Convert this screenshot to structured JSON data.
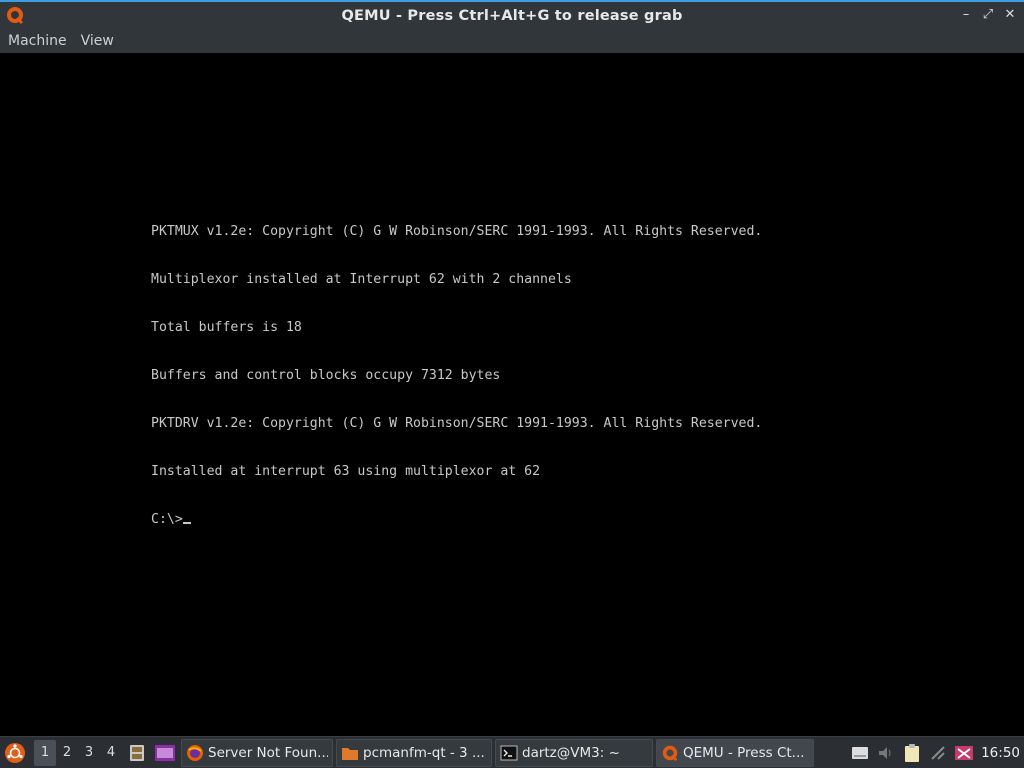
{
  "window": {
    "title": "QEMU - Press Ctrl+Alt+G to release grab",
    "controls": {
      "minimize": "–",
      "restore": "⤢",
      "close": "✕"
    }
  },
  "menu": {
    "items": [
      {
        "label": "Machine"
      },
      {
        "label": "View"
      }
    ]
  },
  "console": {
    "lines": [
      "PKTMUX v1.2e: Copyright (C) G W Robinson/SERC 1991-1993. All Rights Reserved.",
      "Multiplexor installed at Interrupt 62 with 2 channels",
      "Total buffers is 18",
      "Buffers and control blocks occupy 7312 bytes",
      "PKTDRV v1.2e: Copyright (C) G W Robinson/SERC 1991-1993. All Rights Reserved.",
      "Installed at interrupt 63 using multiplexor at 62"
    ],
    "prompt": "C:\\>"
  },
  "taskbar": {
    "desktops": [
      "1",
      "2",
      "3",
      "4"
    ],
    "active_desktop": "1",
    "tasks": [
      {
        "label": "Server Not Foun...",
        "icon": "firefox-icon"
      },
      {
        "label": "pcmanfm-qt - 3 ...",
        "icon": "folder-icon"
      },
      {
        "label": "dartz@VM3: ~",
        "icon": "terminal-icon"
      },
      {
        "label": "QEMU - Press Ct...",
        "icon": "qemu-icon"
      }
    ],
    "clock": "16:50"
  },
  "colors": {
    "titlebar": "#31363b",
    "accent": "#3d9de0",
    "console_text": "#c8c8c8",
    "taskbar": "#2b2f33"
  }
}
